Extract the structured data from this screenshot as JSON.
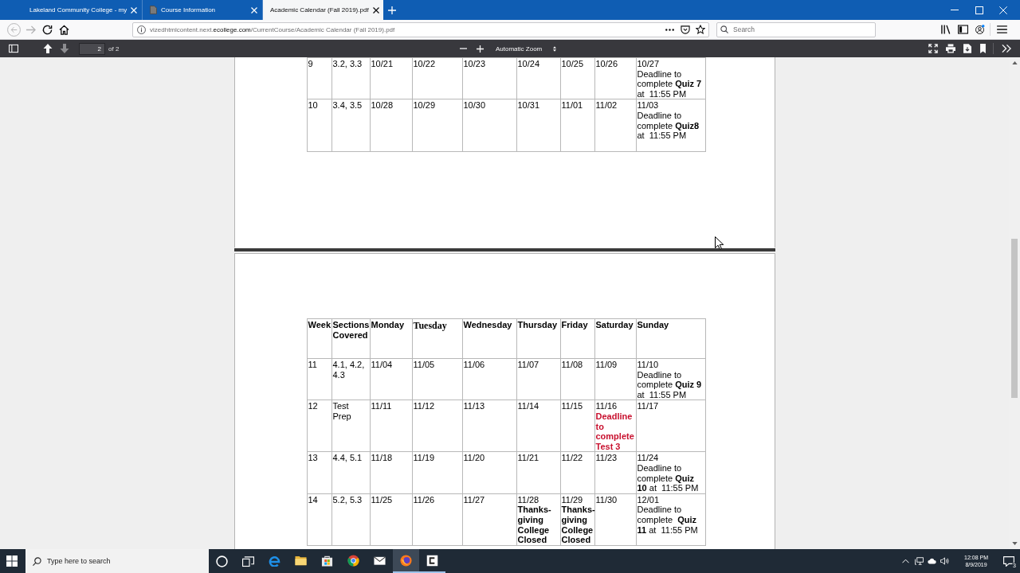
{
  "browser": {
    "tabs": [
      {
        "title": "Lakeland Community College - my",
        "kind": "page",
        "selected": false
      },
      {
        "title": "Course Information",
        "kind": "document",
        "selected": false
      },
      {
        "title": "Academic Calendar (Fall 2019).pdf",
        "kind": "page",
        "selected": true
      }
    ],
    "nav": [
      {
        "kind": "back",
        "disabled": true
      },
      {
        "kind": "forward",
        "disabled": true
      },
      {
        "kind": "reload",
        "disabled": false
      },
      {
        "kind": "home",
        "disabled": false
      }
    ],
    "address": {
      "subdomain": "vizedhtmlcontent.next.",
      "domain": "ecollege.com",
      "path": "/CurrentCourse/Academic Calendar (Fall 2019).pdf"
    },
    "search": {
      "placeholder": "Search"
    }
  },
  "pdf_toolbar": {
    "page_buttons": [
      {
        "kind": "previous",
        "disabled": false
      },
      {
        "kind": "next",
        "disabled": true
      }
    ],
    "page": "2",
    "page_count": "of 2",
    "zoom": "Automatic Zoom"
  },
  "pages": [
    {
      "rows": [
        {
          "week": "9",
          "sections": "3.2, 3.3",
          "days": [
            {
              "date": "10/21"
            },
            {
              "date": "10/22"
            },
            {
              "date": "10/23"
            },
            {
              "date": "10/24"
            },
            {
              "date": "10/25"
            },
            {
              "date": "10/26"
            },
            {
              "date": "10/27",
              "note": {
                "kind": "deadline",
                "text": "Deadline to complete **Quiz 7** at  11:55 PM"
              }
            }
          ]
        },
        {
          "week": "10",
          "sections": "3.4, 3.5",
          "days": [
            {
              "date": "10/28"
            },
            {
              "date": "10/29"
            },
            {
              "date": "10/30"
            },
            {
              "date": "10/31"
            },
            {
              "date": "11/01"
            },
            {
              "date": "11/02"
            },
            {
              "date": "11/03",
              "note": {
                "kind": "deadline",
                "text": "Deadline to complete **Quiz8** at  11:55 PM"
              }
            }
          ]
        }
      ]
    },
    {
      "columns": [
        "Week",
        "Sections Covered",
        "Monday",
        "Tuesday",
        "Wednesday",
        "Thursday",
        "Friday",
        "Saturday",
        "Sunday"
      ],
      "rows": [
        {
          "week": "11",
          "sections": "4.1, 4.2, 4.3",
          "days": [
            {
              "date": "11/04"
            },
            {
              "date": "11/05"
            },
            {
              "date": "11/06"
            },
            {
              "date": "11/07"
            },
            {
              "date": "11/08"
            },
            {
              "date": "11/09"
            },
            {
              "date": "11/10",
              "note": {
                "kind": "deadline",
                "text": "Deadline to complete **Quiz 9** at  11:55 PM"
              }
            }
          ]
        },
        {
          "week": "12",
          "sections": "Test Prep",
          "days": [
            {
              "date": "11/11"
            },
            {
              "date": "11/12"
            },
            {
              "date": "11/13"
            },
            {
              "date": "11/14"
            },
            {
              "date": "11/15"
            },
            {
              "date": "11/16",
              "note": {
                "kind": "alert",
                "text": "Deadline to complete Test 3"
              }
            },
            {
              "date": "11/17"
            }
          ]
        },
        {
          "week": "13",
          "sections": "4.4, 5.1",
          "days": [
            {
              "date": "11/18"
            },
            {
              "date": "11/19"
            },
            {
              "date": "11/20"
            },
            {
              "date": "11/21"
            },
            {
              "date": "11/22"
            },
            {
              "date": "11/23"
            },
            {
              "date": "11/24",
              "note": {
                "kind": "deadline",
                "text": "Deadline to complete **Quiz 10** at  11:55 PM"
              }
            }
          ]
        },
        {
          "week": "14",
          "sections": "5.2, 5.3",
          "days": [
            {
              "date": "11/25"
            },
            {
              "date": "11/26"
            },
            {
              "date": "11/27"
            },
            {
              "date": "11/28",
              "note": {
                "kind": "holiday",
                "text": "Thanks-giving College Closed"
              }
            },
            {
              "date": "11/29",
              "note": {
                "kind": "holiday",
                "text": "Thanks-giving College Closed"
              }
            },
            {
              "date": "11/30"
            },
            {
              "date": "12/01",
              "note": {
                "kind": "deadline",
                "text": "Deadline to complete  **Quiz 11** at  11:55 PM"
              }
            }
          ]
        }
      ]
    }
  ],
  "taskbar": {
    "search": {
      "placeholder": "Type here to search"
    },
    "apps": [
      {
        "kind": "e-browser",
        "running": false,
        "selected": false
      },
      {
        "kind": "folder",
        "running": false,
        "selected": false
      },
      {
        "kind": "store",
        "running": false,
        "selected": false
      },
      {
        "kind": "round-browser",
        "running": false,
        "selected": false
      },
      {
        "kind": "mail",
        "running": false,
        "selected": false
      },
      {
        "kind": "fox-browser",
        "running": true,
        "selected": true
      },
      {
        "kind": "c-app",
        "running": true,
        "selected": false
      }
    ],
    "time": "12:08 PM",
    "date": "8/9/2019",
    "notifications": "3"
  }
}
